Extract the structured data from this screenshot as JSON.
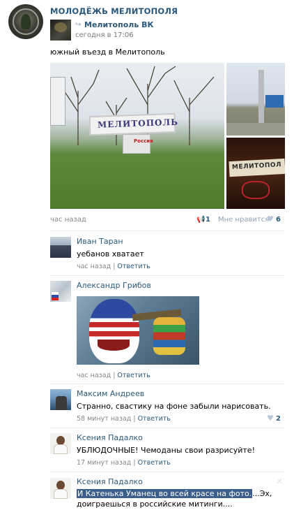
{
  "post": {
    "group_name": "МОЛОДЁЖЬ МЕЛИТОПОЛЯ",
    "source_name": "Мелитополь ВК",
    "source_time": "сегодня в 17:06",
    "text": "южный въезд в Мелитополь",
    "photo_sign_text": "МЕЛИТОПОЛЬ",
    "photo_sign_sub": "Россия",
    "photo_br_text": "МЕЛИТОПОЛ",
    "time_ago": "час назад",
    "share_count": "1",
    "like_label": "Мне нравится",
    "like_count": "6"
  },
  "comments": [
    {
      "name": "Иван Таран",
      "text": "уебанов хватает",
      "time": "час назад",
      "reply": "Ответить"
    },
    {
      "name": "Александр Грибов",
      "time": "час назад",
      "reply": "Ответить"
    },
    {
      "name": "Максим Андреев",
      "text": "Странно, свастику на фоне забыли нарисовать.",
      "time": "58 минут назад",
      "reply": "Ответить",
      "likes": "2"
    },
    {
      "name": "Ксения Падалко",
      "text": "УБЛЮДОЧНЫЕ! Чемоданы свои разрисуйте!",
      "time": "17 минут назад",
      "reply": "Ответить"
    },
    {
      "name": "Ксения Падалко",
      "text_selected": "И Катенька Уманец во всей красе на фото.",
      "text_rest": "...Эх,",
      "text_line2": "доиграешься в российские митинги...."
    }
  ],
  "separator": "|",
  "icons": {
    "repost": "repost-icon",
    "share": "megaphone-icon",
    "like": "heart-icon",
    "close": "close-icon"
  },
  "colors": {
    "link": "#2b587a",
    "meta": "#888888",
    "selection": "#3b5f8a"
  }
}
